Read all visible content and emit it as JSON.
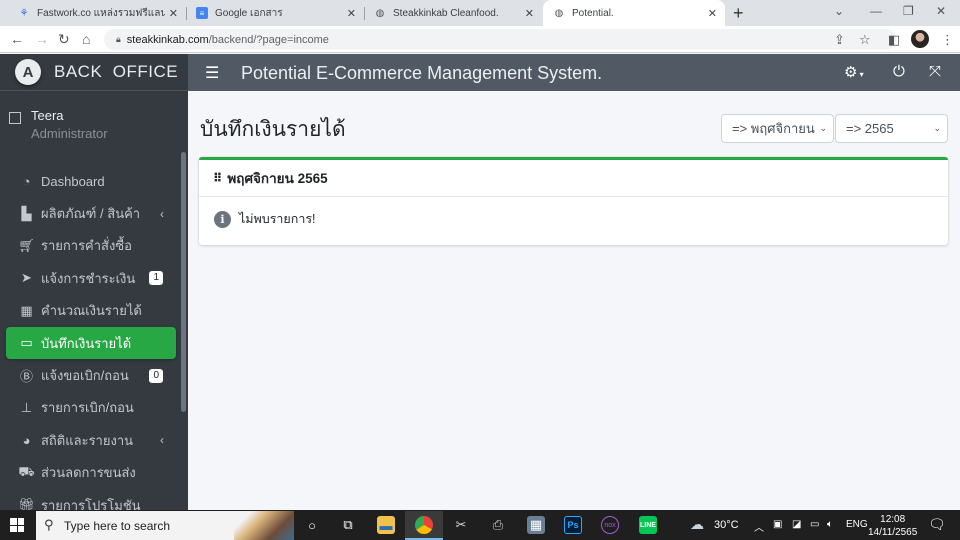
{
  "browser": {
    "tabs": [
      {
        "title": "Fastwork.co แหล่งรวมฟรีแลนซ์คุณภ",
        "icon": "fastwork-icon"
      },
      {
        "title": "Google เอกสาร",
        "icon": "google-docs-icon"
      },
      {
        "title": "Steakkinkab Cleanfood.",
        "icon": "globe-icon"
      },
      {
        "title": "Potential.",
        "icon": "globe-icon",
        "active": true
      }
    ],
    "url_host": "steakkinkab.com",
    "url_path": "/backend/?page=income"
  },
  "sidebar": {
    "brand": "BACK  OFFICE",
    "brand_logo": "A",
    "user_name": "Teera",
    "user_role": "Administrator",
    "items": [
      {
        "label": "Dashboard",
        "icon": "dashboard-icon"
      },
      {
        "label": "ผลิตภัณฑ์ / สินค้า",
        "icon": "products-icon",
        "has_children": true
      },
      {
        "label": "รายการคำสั่งซื้อ",
        "icon": "cart-icon"
      },
      {
        "label": "แจ้งการชำระเงิน",
        "icon": "paper-plane-icon",
        "badge": "1"
      },
      {
        "label": "คำนวณเงินรายได้",
        "icon": "calculator-icon"
      },
      {
        "label": "บันทึกเงินรายได้",
        "icon": "wallet-icon",
        "active": true
      },
      {
        "label": "แจ้งขอเบิก/ถอน",
        "icon": "bitcoin-icon",
        "badge": "0"
      },
      {
        "label": "รายการเบิก/ถอน",
        "icon": "stamp-icon"
      },
      {
        "label": "สถิติและรายงาน",
        "icon": "chart-pie-icon",
        "has_children": true
      },
      {
        "label": "ส่วนลดการขนส่ง",
        "icon": "car-icon"
      },
      {
        "label": "รายการโปรโมชัน",
        "icon": "gift-icon"
      }
    ]
  },
  "topnav": {
    "title": "Potential E-Commerce Management System."
  },
  "main": {
    "page_title": "บันทึกเงินรายได้",
    "month_select": "=> พฤศจิกายน",
    "year_select": "=> 2565",
    "card_title": "พฤศจิกายน 2565",
    "empty_message": "ไม่พบรายการ!"
  },
  "colors": {
    "accent": "#28a745",
    "sidebar_bg": "#343a40",
    "topnav_bg": "#515a64"
  },
  "taskbar": {
    "search_placeholder": "Type here to search",
    "weather": "30°C",
    "language": "ENG",
    "time": "12:08",
    "date": "14/11/2565"
  }
}
